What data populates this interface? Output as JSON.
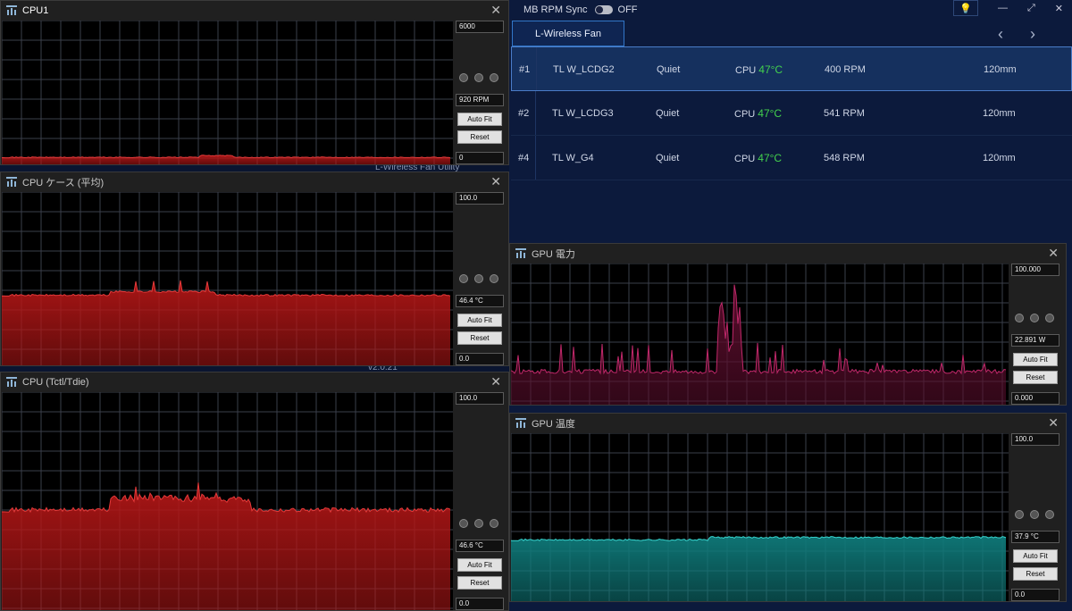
{
  "background_app": {
    "mb_rpm_sync_label": "MB RPM Sync",
    "mb_rpm_sync_state": "OFF",
    "fan_tab": "L-Wireless Fan",
    "title_fragment": "L-Wireless Fan Utility",
    "version_fragment": "v2.0.21",
    "fans": [
      {
        "id": "#1",
        "name": "TL W_LCDG2",
        "mode": "Quiet",
        "source": "CPU",
        "temp": "47°C",
        "rpm": "400 RPM",
        "size": "120mm"
      },
      {
        "id": "#2",
        "name": "TL W_LCDG3",
        "mode": "Quiet",
        "source": "CPU",
        "temp": "47°C",
        "rpm": "541 RPM",
        "size": "120mm"
      },
      {
        "id": "#4",
        "name": "TL W_G4",
        "mode": "Quiet",
        "source": "CPU",
        "temp": "47°C",
        "rpm": "548 RPM",
        "size": "120mm"
      }
    ]
  },
  "monitors": [
    {
      "title": "CPU1",
      "max": "6000",
      "current": "920 RPM",
      "min": "0",
      "auto_fit": "Auto Fit",
      "reset": "Reset",
      "color": "#b11616",
      "line": "#e53a3a",
      "level": 0.046,
      "kind": "flat"
    },
    {
      "title": "CPU ケース (平均)",
      "max": "100.0",
      "current": "46.4 °C",
      "min": "0.0",
      "auto_fit": "Auto Fit",
      "reset": "Reset",
      "color": "#b11616",
      "line": "#e53a3a",
      "level": 0.464,
      "kind": "case"
    },
    {
      "title": "CPU (Tctl/Tdie)",
      "max": "100.0",
      "current": "46.6 °C",
      "min": "0.0",
      "auto_fit": "Auto Fit",
      "reset": "Reset",
      "color": "#b11616",
      "line": "#e53a3a",
      "level": 0.466,
      "kind": "tctl"
    },
    {
      "title": "GPU 電力",
      "max": "100.000",
      "current": "22.891 W",
      "min": "0.000",
      "auto_fit": "Auto Fit",
      "reset": "Reset",
      "color": "#5a0d2c",
      "line": "#c0286a",
      "level": 0.23,
      "kind": "power"
    },
    {
      "title": "GPU 温度",
      "max": "100.0",
      "current": "37.9 °C",
      "min": "0.0",
      "auto_fit": "Auto Fit",
      "reset": "Reset",
      "color": "#0f7a7a",
      "line": "#37d6d0",
      "level": 0.379,
      "kind": "temp"
    }
  ],
  "colors": {
    "accent": "#3276c8",
    "temp_ok": "#43d14d"
  }
}
